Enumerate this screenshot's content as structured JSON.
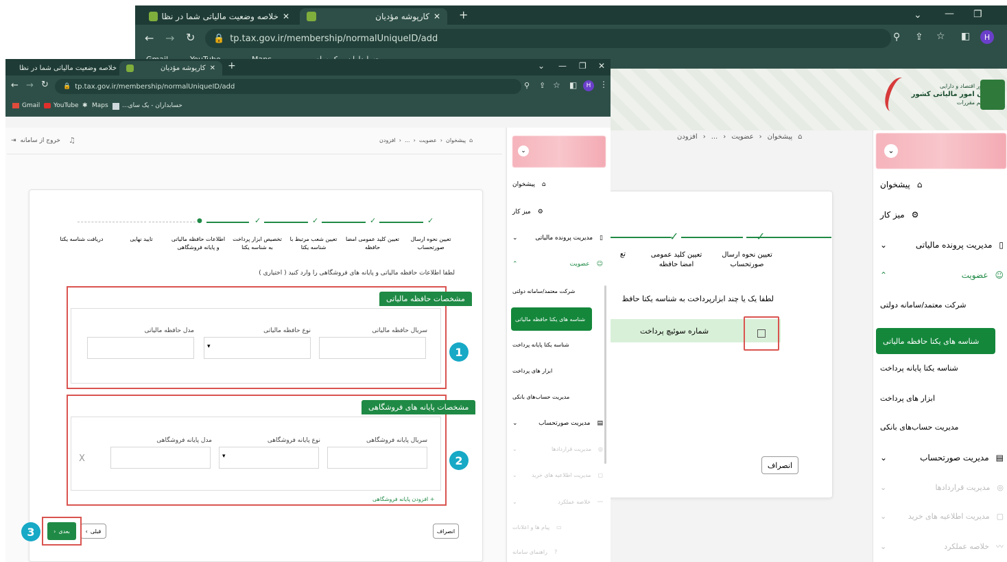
{
  "back_window": {
    "tabs": [
      {
        "title": "خلاصه وضعیت مالیاتی شما در نظا"
      },
      {
        "title": "کارپوشه مؤدیان"
      }
    ],
    "new_tab": "+",
    "url": "tp.tax.gov.ir/membership/normalUniqueID/add",
    "bookmarks": [
      {
        "label": "Gmail"
      },
      {
        "label": "YouTube"
      },
      {
        "label": "Maps"
      },
      {
        "label": "حسابداران - یک سای..."
      }
    ],
    "profile_initial": "H",
    "logo_text": [
      "وزارت امور اقتصاد و دارایی",
      "سازمان امور مالیاتی کشور",
      "مرکز تنظیم مقررات"
    ],
    "breadcrumb": [
      "پیشخوان",
      "عضویت",
      "...",
      "افزودن"
    ],
    "sidebar_items": [
      {
        "label": "پیشخوان"
      },
      {
        "label": "میز کار"
      },
      {
        "label": "مدیریت پرونده مالیاتی"
      },
      {
        "label": "عضویت"
      },
      {
        "label": "شرکت معتمد/سامانه دولتی"
      },
      {
        "label": "شناسه های یکتا حافظه مالیاتی"
      },
      {
        "label": "شناسه یکتا پایانه پرداخت"
      },
      {
        "label": "ابزار های پرداخت"
      },
      {
        "label": "مدیریت حساب‌های بانکی"
      },
      {
        "label": "مدیریت صورتحساب"
      },
      {
        "label": "مدیریت قراردادها"
      },
      {
        "label": "مدیریت اطلاعیه های خرید"
      },
      {
        "label": "خلاصه عملکرد"
      }
    ],
    "steps": [
      {
        "label": "تعیین نحوه ارسال صورتحساب"
      },
      {
        "label": "تعیین کلید عمومی امضا حافظه"
      },
      {
        "label": "تع"
      }
    ],
    "instruction": "لطفا یک یا چند ابزارپرداخت به شناسه یکتا حافظ",
    "checkbox_label": "شماره سوئیچ پرداخت",
    "cancel_button": "انصراف"
  },
  "front_window": {
    "tabs": [
      {
        "title": "خلاصه وضعیت مالیاتی شما در نظا"
      },
      {
        "title": "کارپوشه مؤدیان"
      }
    ],
    "new_tab": "+",
    "url": "tp.tax.gov.ir/membership/normalUniqueID/add",
    "bookmarks": [
      {
        "label": "Gmail"
      },
      {
        "label": "YouTube"
      },
      {
        "label": "Maps"
      },
      {
        "label": "حسابداران - یک سای..."
      }
    ],
    "profile_initial": "H",
    "breadcrumb": [
      "پیشخوان",
      "عضویت",
      "...",
      "افزودن"
    ],
    "logout_label": "خروج از سامانه",
    "sidebar_items": [
      {
        "label": "پیشخوان"
      },
      {
        "label": "میز کار"
      },
      {
        "label": "مدیریت پرونده مالیاتی"
      },
      {
        "label": "عضویت"
      },
      {
        "label": "شرکت معتمد/سامانه دولتی"
      },
      {
        "label": "شناسه های یکتا حافظه مالیاتی"
      },
      {
        "label": "شناسه یکتا پایانه پرداخت"
      },
      {
        "label": "ابزار های پرداخت"
      },
      {
        "label": "مدیریت حساب‌های بانکی"
      },
      {
        "label": "مدیریت صورتحساب"
      },
      {
        "label": "مدیریت قراردادها"
      },
      {
        "label": "مدیریت اطلاعیه های خرید"
      },
      {
        "label": "خلاصه عملکرد"
      },
      {
        "label": "پیام ها و اعلانات"
      },
      {
        "label": "راهنمای سامانه"
      }
    ],
    "steps": [
      {
        "label": "تعیین نحوه ارسال صورتحساب"
      },
      {
        "label": "تعیین کلید عمومی امضا حافظه"
      },
      {
        "label": "تعیین شعب مرتبط با شناسه یکتا"
      },
      {
        "label": "تخصیص ابزار پرداخت به شناسه یکتا"
      },
      {
        "label": "اطلاعات حافظه مالیاتی و پایانه فروشگاهی"
      },
      {
        "label": "تایید نهایی"
      },
      {
        "label": "دریافت شناسه یکتا"
      }
    ],
    "instruction": "لطفا اطلاعات حافظه مالیاتی و پایانه های فروشگاهی را وارد کنید ( اختیاری )",
    "section1": {
      "title": "مشخصات حافظه مالیاتی",
      "labels": [
        "سریال حافظه مالیاتی",
        "نوع حافظه مالیاتی",
        "مدل حافظه مالیاتی"
      ]
    },
    "section2": {
      "title": "مشخصات پایانه های فروشگاهی",
      "labels": [
        "سریال پایانه فروشگاهی",
        "نوع پایانه فروشگاهی",
        "مدل پایانه فروشگاهی"
      ],
      "add_link": "+ افزودن پایانه فروشگاهی",
      "remove": "X"
    },
    "buttons": {
      "cancel": "انصراف",
      "prev": "قبلی",
      "next": "بعدی"
    },
    "markers": [
      "1",
      "2",
      "3"
    ]
  }
}
